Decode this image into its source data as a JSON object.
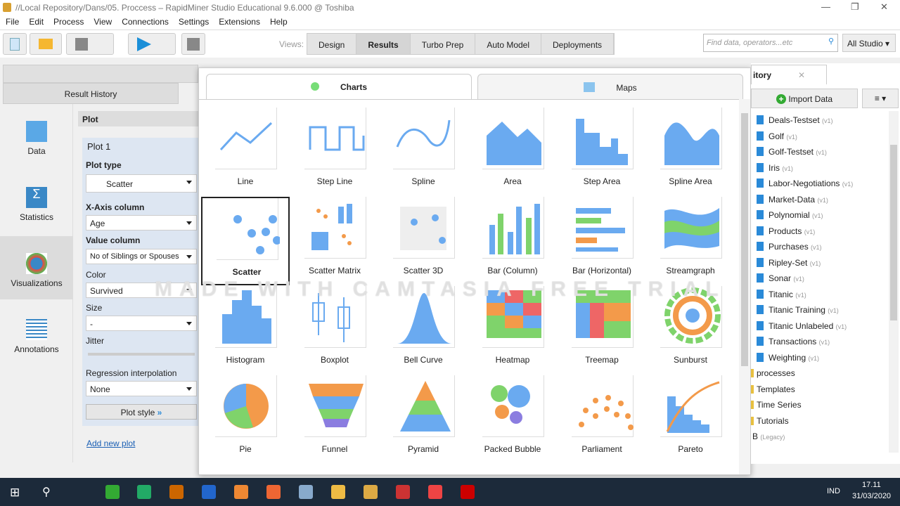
{
  "window": {
    "title": "//Local Repository/Dans/05. Proccess – RapidMiner Studio Educational 9.6.000 @ Toshiba",
    "min": "—",
    "max": "❐",
    "close": "✕"
  },
  "menu": [
    "File",
    "Edit",
    "Process",
    "View",
    "Connections",
    "Settings",
    "Extensions",
    "Help"
  ],
  "toolbar": {
    "views_label": "Views:",
    "views": [
      "Design",
      "Results",
      "Turbo Prep",
      "Auto Model",
      "Deployments"
    ],
    "active_view": "Results",
    "search_placeholder": "Find data, operators...etc",
    "perspective": "All Studio"
  },
  "result_history": "Result History",
  "left_nav": [
    {
      "label": "Data"
    },
    {
      "label": "Statistics"
    },
    {
      "label": "Visualizations"
    },
    {
      "label": "Annotations"
    }
  ],
  "plot_panel": {
    "header": "Plot",
    "plot_name": "Plot 1",
    "plot_type_label": "Plot type",
    "plot_type": "Scatter",
    "x_label": "X-Axis column",
    "x_value": "Age",
    "value_label": "Value column",
    "value_value": "No of Siblings or Spouses",
    "color_label": "Color",
    "color_value": "Survived",
    "size_label": "Size",
    "size_value": "-",
    "jitter_label": "Jitter",
    "regression_label": "Regression interpolation",
    "regression_value": "None",
    "plot_style": "Plot style",
    "add_plot": "Add new plot"
  },
  "popup": {
    "tabs": [
      "Charts",
      "Maps"
    ],
    "selected": "Scatter",
    "charts": [
      "Line",
      "Step Line",
      "Spline",
      "Area",
      "Step Area",
      "Spline Area",
      "Scatter",
      "Scatter Matrix",
      "Scatter 3D",
      "Bar (Column)",
      "Bar (Horizontal)",
      "Streamgraph",
      "Histogram",
      "Boxplot",
      "Bell Curve",
      "Heatmap",
      "Treemap",
      "Sunburst",
      "Pie",
      "Funnel",
      "Pyramid",
      "Packed Bubble",
      "Parliament",
      "Pareto"
    ]
  },
  "watermark": "MADE WITH CAMTASIA FREE TRIAL",
  "repository": {
    "tab": "itory",
    "import": "Import Data",
    "items": [
      {
        "name": "Deals-Testset",
        "v": "(v1)"
      },
      {
        "name": "Golf",
        "v": "(v1)"
      },
      {
        "name": "Golf-Testset",
        "v": "(v1)"
      },
      {
        "name": "Iris",
        "v": "(v1)"
      },
      {
        "name": "Labor-Negotiations",
        "v": "(v1)"
      },
      {
        "name": "Market-Data",
        "v": "(v1)"
      },
      {
        "name": "Polynomial",
        "v": "(v1)"
      },
      {
        "name": "Products",
        "v": "(v1)"
      },
      {
        "name": "Purchases",
        "v": "(v1)"
      },
      {
        "name": "Ripley-Set",
        "v": "(v1)"
      },
      {
        "name": "Sonar",
        "v": "(v1)"
      },
      {
        "name": "Titanic",
        "v": "(v1)"
      },
      {
        "name": "Titanic Training",
        "v": "(v1)"
      },
      {
        "name": "Titanic Unlabeled",
        "v": "(v1)"
      },
      {
        "name": "Transactions",
        "v": "(v1)"
      },
      {
        "name": "Weighting",
        "v": "(v1)"
      }
    ],
    "folders": [
      "processes",
      "Templates",
      "Time Series",
      "Tutorials"
    ],
    "legacy": "B",
    "legacy_tag": "(Legacy)"
  },
  "taskbar": {
    "lang": "IND",
    "time": "17.11",
    "date": "31/03/2020"
  }
}
